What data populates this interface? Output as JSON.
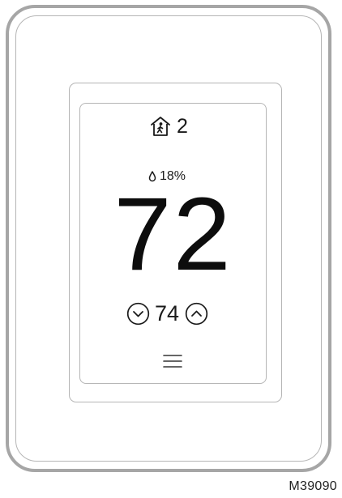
{
  "device": {
    "occupancy_count": "2",
    "humidity": "18%",
    "indoor_temperature": "72",
    "setpoint": "74"
  },
  "icons": {
    "occupancy": "home-person-icon",
    "humidity": "water-drop-icon",
    "decrease": "chevron-down-circle-icon",
    "increase": "chevron-up-circle-icon",
    "menu": "hamburger-menu-icon"
  },
  "figure_id": "M39090",
  "colors": {
    "frame": "#a6a6a6",
    "line": "#b5b5b5",
    "text": "#111111"
  }
}
